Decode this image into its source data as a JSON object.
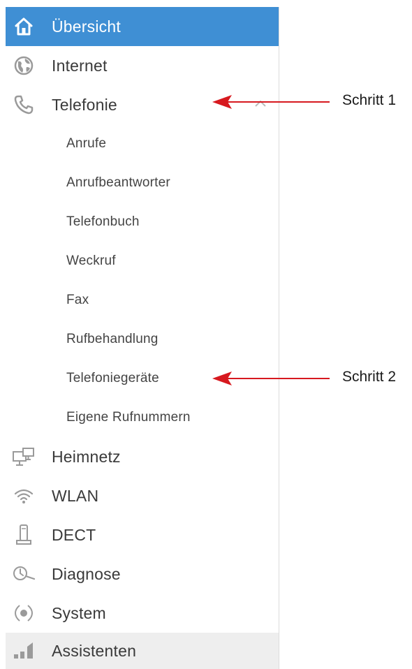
{
  "menu": {
    "overview": "Übersicht",
    "internet": "Internet",
    "telephony": "Telefonie",
    "home_network": "Heimnetz",
    "wlan": "WLAN",
    "dect": "DECT",
    "diagnostics": "Diagnose",
    "system": "System",
    "assistants": "Assistenten"
  },
  "submenu": {
    "items": [
      "Anrufe",
      "Anrufbeantworter",
      "Telefonbuch",
      "Weckruf",
      "Fax",
      "Rufbehandlung",
      "Telefoniegeräte",
      "Eigene Rufnummern"
    ]
  },
  "annotations": {
    "step1": "Schritt 1",
    "step2": "Schritt 2"
  },
  "colors": {
    "active_bg": "#3f8fd4",
    "arrow": "#d7191f",
    "icon_gray": "#9a9a9a",
    "assistant_bg": "#eeeeee"
  },
  "icons": {
    "overview": "home-icon",
    "internet": "globe-icon",
    "telephony": "phone-icon",
    "home_network": "network-icon",
    "wlan": "wifi-icon",
    "dect": "handset-icon",
    "diagnostics": "diagnose-icon",
    "system": "system-icon",
    "assistants": "assistant-icon"
  }
}
